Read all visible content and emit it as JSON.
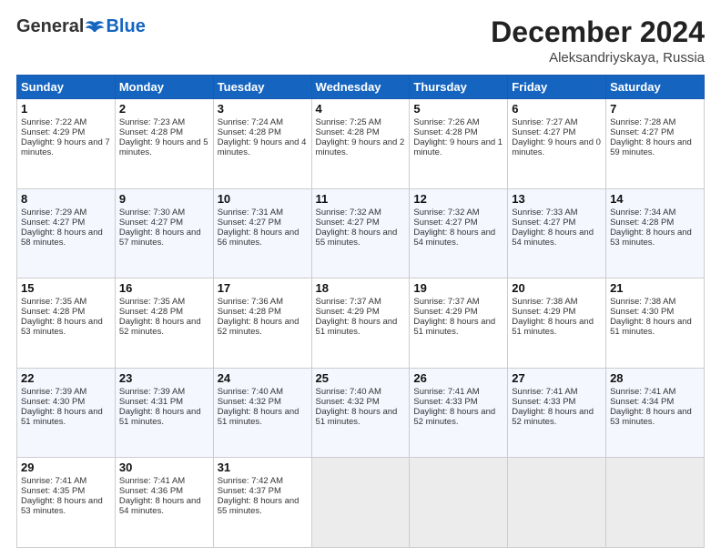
{
  "header": {
    "logo_general": "General",
    "logo_blue": "Blue",
    "month": "December 2024",
    "location": "Aleksandriyskaya, Russia"
  },
  "days_of_week": [
    "Sunday",
    "Monday",
    "Tuesday",
    "Wednesday",
    "Thursday",
    "Friday",
    "Saturday"
  ],
  "weeks": [
    [
      {
        "day": "1",
        "sunrise": "7:22 AM",
        "sunset": "4:29 PM",
        "daylight": "9 hours and 7 minutes."
      },
      {
        "day": "2",
        "sunrise": "7:23 AM",
        "sunset": "4:28 PM",
        "daylight": "9 hours and 5 minutes."
      },
      {
        "day": "3",
        "sunrise": "7:24 AM",
        "sunset": "4:28 PM",
        "daylight": "9 hours and 4 minutes."
      },
      {
        "day": "4",
        "sunrise": "7:25 AM",
        "sunset": "4:28 PM",
        "daylight": "9 hours and 2 minutes."
      },
      {
        "day": "5",
        "sunrise": "7:26 AM",
        "sunset": "4:28 PM",
        "daylight": "9 hours and 1 minute."
      },
      {
        "day": "6",
        "sunrise": "7:27 AM",
        "sunset": "4:27 PM",
        "daylight": "9 hours and 0 minutes."
      },
      {
        "day": "7",
        "sunrise": "7:28 AM",
        "sunset": "4:27 PM",
        "daylight": "8 hours and 59 minutes."
      }
    ],
    [
      {
        "day": "8",
        "sunrise": "7:29 AM",
        "sunset": "4:27 PM",
        "daylight": "8 hours and 58 minutes."
      },
      {
        "day": "9",
        "sunrise": "7:30 AM",
        "sunset": "4:27 PM",
        "daylight": "8 hours and 57 minutes."
      },
      {
        "day": "10",
        "sunrise": "7:31 AM",
        "sunset": "4:27 PM",
        "daylight": "8 hours and 56 minutes."
      },
      {
        "day": "11",
        "sunrise": "7:32 AM",
        "sunset": "4:27 PM",
        "daylight": "8 hours and 55 minutes."
      },
      {
        "day": "12",
        "sunrise": "7:32 AM",
        "sunset": "4:27 PM",
        "daylight": "8 hours and 54 minutes."
      },
      {
        "day": "13",
        "sunrise": "7:33 AM",
        "sunset": "4:27 PM",
        "daylight": "8 hours and 54 minutes."
      },
      {
        "day": "14",
        "sunrise": "7:34 AM",
        "sunset": "4:28 PM",
        "daylight": "8 hours and 53 minutes."
      }
    ],
    [
      {
        "day": "15",
        "sunrise": "7:35 AM",
        "sunset": "4:28 PM",
        "daylight": "8 hours and 53 minutes."
      },
      {
        "day": "16",
        "sunrise": "7:35 AM",
        "sunset": "4:28 PM",
        "daylight": "8 hours and 52 minutes."
      },
      {
        "day": "17",
        "sunrise": "7:36 AM",
        "sunset": "4:28 PM",
        "daylight": "8 hours and 52 minutes."
      },
      {
        "day": "18",
        "sunrise": "7:37 AM",
        "sunset": "4:29 PM",
        "daylight": "8 hours and 51 minutes."
      },
      {
        "day": "19",
        "sunrise": "7:37 AM",
        "sunset": "4:29 PM",
        "daylight": "8 hours and 51 minutes."
      },
      {
        "day": "20",
        "sunrise": "7:38 AM",
        "sunset": "4:29 PM",
        "daylight": "8 hours and 51 minutes."
      },
      {
        "day": "21",
        "sunrise": "7:38 AM",
        "sunset": "4:30 PM",
        "daylight": "8 hours and 51 minutes."
      }
    ],
    [
      {
        "day": "22",
        "sunrise": "7:39 AM",
        "sunset": "4:30 PM",
        "daylight": "8 hours and 51 minutes."
      },
      {
        "day": "23",
        "sunrise": "7:39 AM",
        "sunset": "4:31 PM",
        "daylight": "8 hours and 51 minutes."
      },
      {
        "day": "24",
        "sunrise": "7:40 AM",
        "sunset": "4:32 PM",
        "daylight": "8 hours and 51 minutes."
      },
      {
        "day": "25",
        "sunrise": "7:40 AM",
        "sunset": "4:32 PM",
        "daylight": "8 hours and 51 minutes."
      },
      {
        "day": "26",
        "sunrise": "7:41 AM",
        "sunset": "4:33 PM",
        "daylight": "8 hours and 52 minutes."
      },
      {
        "day": "27",
        "sunrise": "7:41 AM",
        "sunset": "4:33 PM",
        "daylight": "8 hours and 52 minutes."
      },
      {
        "day": "28",
        "sunrise": "7:41 AM",
        "sunset": "4:34 PM",
        "daylight": "8 hours and 53 minutes."
      }
    ],
    [
      {
        "day": "29",
        "sunrise": "7:41 AM",
        "sunset": "4:35 PM",
        "daylight": "8 hours and 53 minutes."
      },
      {
        "day": "30",
        "sunrise": "7:41 AM",
        "sunset": "4:36 PM",
        "daylight": "8 hours and 54 minutes."
      },
      {
        "day": "31",
        "sunrise": "7:42 AM",
        "sunset": "4:37 PM",
        "daylight": "8 hours and 55 minutes."
      },
      null,
      null,
      null,
      null
    ]
  ],
  "labels": {
    "sunrise": "Sunrise:",
    "sunset": "Sunset:",
    "daylight": "Daylight:"
  }
}
